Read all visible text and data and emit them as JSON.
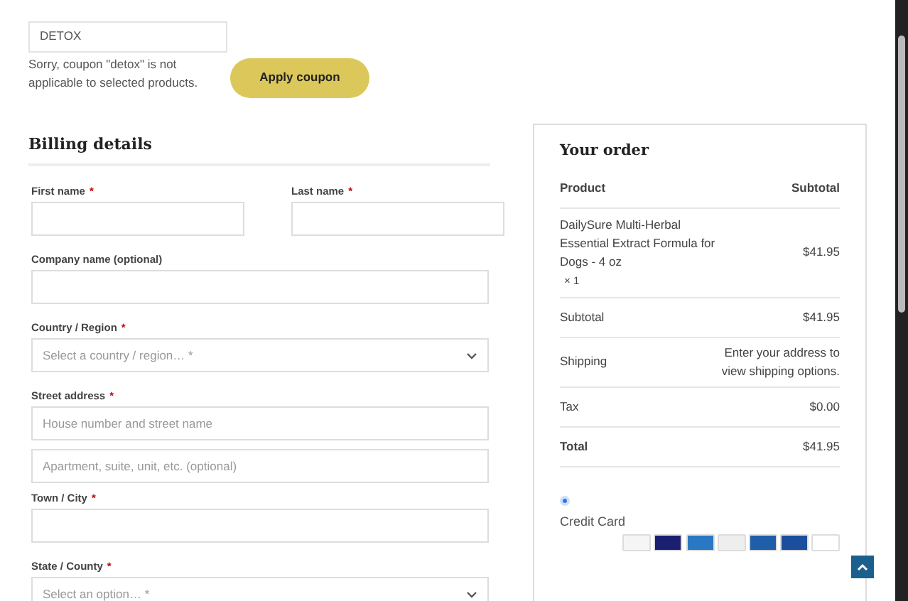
{
  "coupon": {
    "value": "DETOX",
    "message": "Sorry, coupon \"detox\" is not applicable to selected products.",
    "button": "Apply coupon"
  },
  "billing": {
    "title": "Billing details",
    "fields": [
      {
        "kind": "half",
        "label": "First name",
        "required_mark": "*"
      },
      {
        "kind": "half",
        "label": "Last name",
        "required_mark": "*"
      },
      {
        "kind": "text",
        "label": "Company name (optional)"
      },
      {
        "kind": "select",
        "label": "Country / Region",
        "required_mark": "*",
        "placeholder": "Select a country / region… *"
      },
      {
        "kind": "text",
        "label": "Street address",
        "required_mark": "*",
        "placeholder": "House number and street name"
      },
      {
        "kind": "text",
        "placeholder": "Apartment, suite, unit, etc. (optional)"
      },
      {
        "kind": "text",
        "label": "Town / City",
        "required_mark": "*"
      },
      {
        "kind": "select",
        "label": "State / County",
        "required_mark": "*",
        "placeholder": "Select an option… *"
      }
    ]
  },
  "order": {
    "title": "Your order",
    "columns": [
      "Product",
      "Subtotal"
    ],
    "product": {
      "name": "DailySure Multi-Herbal Essential Extract Formula for Dogs - 4 oz",
      "quantity": "× 1",
      "price": "$41.95"
    },
    "rows": [
      {
        "kind": "line",
        "label": "Subtotal",
        "value": "$41.95"
      },
      {
        "kind": "note",
        "label": "Shipping",
        "value": "Enter your address to view shipping options."
      },
      {
        "kind": "line",
        "label": "Tax",
        "value": "$0.00"
      },
      {
        "kind": "total",
        "label": "Total",
        "value": "$41.95"
      }
    ],
    "payment": {
      "selected": true,
      "label": "Credit Card"
    }
  }
}
